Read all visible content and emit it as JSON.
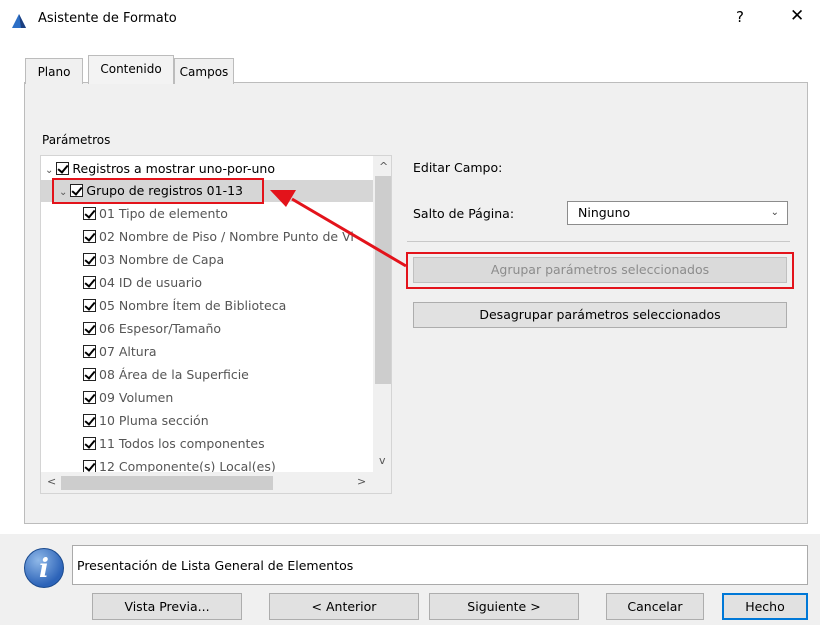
{
  "window": {
    "title": "Asistente de Formato",
    "help": "?",
    "close": "✕"
  },
  "tabs": [
    {
      "label": "Plano"
    },
    {
      "label": "Contenido",
      "active": true
    },
    {
      "label": "Campos"
    }
  ],
  "params": {
    "label": "Parámetros",
    "tree": {
      "root": {
        "label": "Registros a mostrar uno-por-uno",
        "checked": true,
        "expanded": true
      },
      "group": {
        "label": "Grupo de registros 01-13",
        "checked": true,
        "expanded": true,
        "selected": true
      },
      "children": [
        {
          "label": "01 Tipo de elemento"
        },
        {
          "label": "02 Nombre de Piso / Nombre Punto de Vi"
        },
        {
          "label": "03 Nombre de Capa"
        },
        {
          "label": "04 ID de usuario"
        },
        {
          "label": "05 Nombre Ítem de Biblioteca"
        },
        {
          "label": "06 Espesor/Tamaño"
        },
        {
          "label": "07 Altura"
        },
        {
          "label": "08 Área de la Superficie"
        },
        {
          "label": "09 Volumen"
        },
        {
          "label": "10 Pluma sección"
        },
        {
          "label": "11 Todos los componentes"
        },
        {
          "label": "12 Componente(s) Local(es)"
        }
      ]
    },
    "scroll": {
      "up": "^",
      "down": "v",
      "left": "<",
      "right": ">"
    }
  },
  "editor": {
    "edit_field_label": "Editar Campo:",
    "page_break_label": "Salto de Página:",
    "page_break_value": "Ninguno",
    "group_button": "Agrupar parámetros seleccionados",
    "ungroup_button": "Desagrupar parámetros seleccionados"
  },
  "status": {
    "text": "Presentación de Lista General de Elementos",
    "icon": "info-icon",
    "icon_glyph": "i"
  },
  "footer": {
    "preview": "Vista Previa...",
    "back": "< Anterior",
    "next": "Siguiente >",
    "cancel": "Cancelar",
    "done": "Hecho"
  },
  "colors": {
    "annotation_red": "#e3131b",
    "default_button_border": "#0078d7"
  }
}
